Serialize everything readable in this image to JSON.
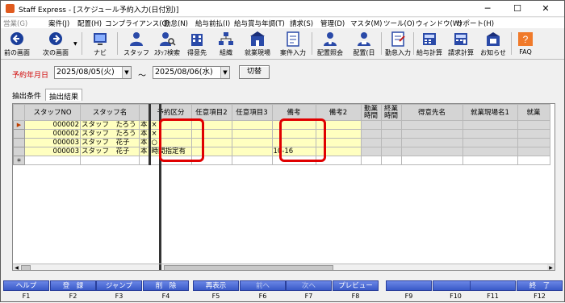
{
  "window": {
    "title": "Staff Express - [スケジュール予約入力(日付別)]",
    "minimize": "─",
    "maximize": "☐",
    "close": "✕"
  },
  "menu": [
    "営業(G)",
    "案件(J)",
    "配置(H)",
    "コンプライアンス(C)",
    "勤怠(N)",
    "給与前払(I)",
    "給与賞与年調(T)",
    "請求(S)",
    "管理(D)",
    "マスタ(M)",
    "ツール(O)",
    "ウィンドウ(W)",
    "サポート(H)"
  ],
  "toolbar": [
    {
      "label": "前の画面",
      "icon": "back-arrow-icon"
    },
    {
      "label": "次の画面",
      "icon": "forward-arrow-icon"
    },
    {
      "label": "ナビ",
      "icon": "navi-icon"
    },
    {
      "label": "スタッフ",
      "icon": "staff-icon"
    },
    {
      "label": "ｽﾀｯﾌ検索",
      "icon": "staff-search-icon"
    },
    {
      "label": "得意先",
      "icon": "client-icon"
    },
    {
      "label": "組織",
      "icon": "organization-icon"
    },
    {
      "label": "就業現場",
      "icon": "worksite-icon"
    },
    {
      "label": "案件入力",
      "icon": "case-entry-icon"
    },
    {
      "label": "配置照会",
      "icon": "assignment-inquiry-icon"
    },
    {
      "label": "配置(日",
      "icon": "assignment-day-icon"
    },
    {
      "label": "勤怠入力",
      "icon": "attendance-entry-icon"
    },
    {
      "label": "給与計算",
      "icon": "payroll-icon"
    },
    {
      "label": "請求計算",
      "icon": "billing-icon"
    },
    {
      "label": "お知らせ",
      "icon": "notice-icon"
    },
    {
      "label": "FAQ",
      "icon": "faq-icon"
    }
  ],
  "date_filter": {
    "label": "予約年月日",
    "from": "2025/08/05(火)",
    "tilde": "～",
    "to": "2025/08/06(水)",
    "switch_button": "切替"
  },
  "tabs": [
    "抽出条件",
    "抽出結果"
  ],
  "grid": {
    "headers": [
      "スタッフNO",
      "スタッフ名",
      "",
      "予約区分",
      "任意項目2",
      "任意項目3",
      "備考",
      "備考2",
      "勤業時間",
      "終業時間",
      "得意先名",
      "就業現場名1",
      "就業"
    ],
    "rows": [
      {
        "indicator": "▶",
        "staff_no": "000002",
        "name": "スタッフ　たろう",
        "extra": "本",
        "kubun": "×",
        "biko": ""
      },
      {
        "indicator": "",
        "staff_no": "000002",
        "name": "スタッフ　たろう",
        "extra": "本",
        "kubun": "×",
        "biko": ""
      },
      {
        "indicator": "",
        "staff_no": "000003",
        "name": "スタッフ　花子",
        "extra": "本",
        "kubun": "○",
        "biko": ""
      },
      {
        "indicator": "",
        "staff_no": "000003",
        "name": "スタッフ　花子",
        "extra": "本",
        "kubun": "時間指定有",
        "biko": "10-16"
      },
      {
        "indicator": "＊",
        "staff_no": "",
        "name": "",
        "extra": "",
        "kubun": "",
        "biko": ""
      }
    ]
  },
  "fkeys": [
    {
      "label": "ヘルプ",
      "key": "F1",
      "enabled": true
    },
    {
      "label": "登　録",
      "key": "F2",
      "enabled": true
    },
    {
      "label": "ジャンプ",
      "key": "F3",
      "enabled": true
    },
    {
      "label": "削　除",
      "key": "F4",
      "enabled": true
    },
    {
      "label": "再表示",
      "key": "F5",
      "enabled": true
    },
    {
      "label": "前へ",
      "key": "F6",
      "enabled": false
    },
    {
      "label": "次へ",
      "key": "F7",
      "enabled": false
    },
    {
      "label": "プレビュー",
      "key": "F8",
      "enabled": true
    },
    {
      "label": "",
      "key": "F9",
      "enabled": false
    },
    {
      "label": "",
      "key": "F10",
      "enabled": false
    },
    {
      "label": "",
      "key": "F11",
      "enabled": false
    },
    {
      "label": "終　了",
      "key": "F12",
      "enabled": true
    }
  ],
  "colors": {
    "required_label": "#d00000",
    "editable_cell": "#ffffc0",
    "highlight_box": "#e00000",
    "fkey": "#4a6ad8"
  }
}
